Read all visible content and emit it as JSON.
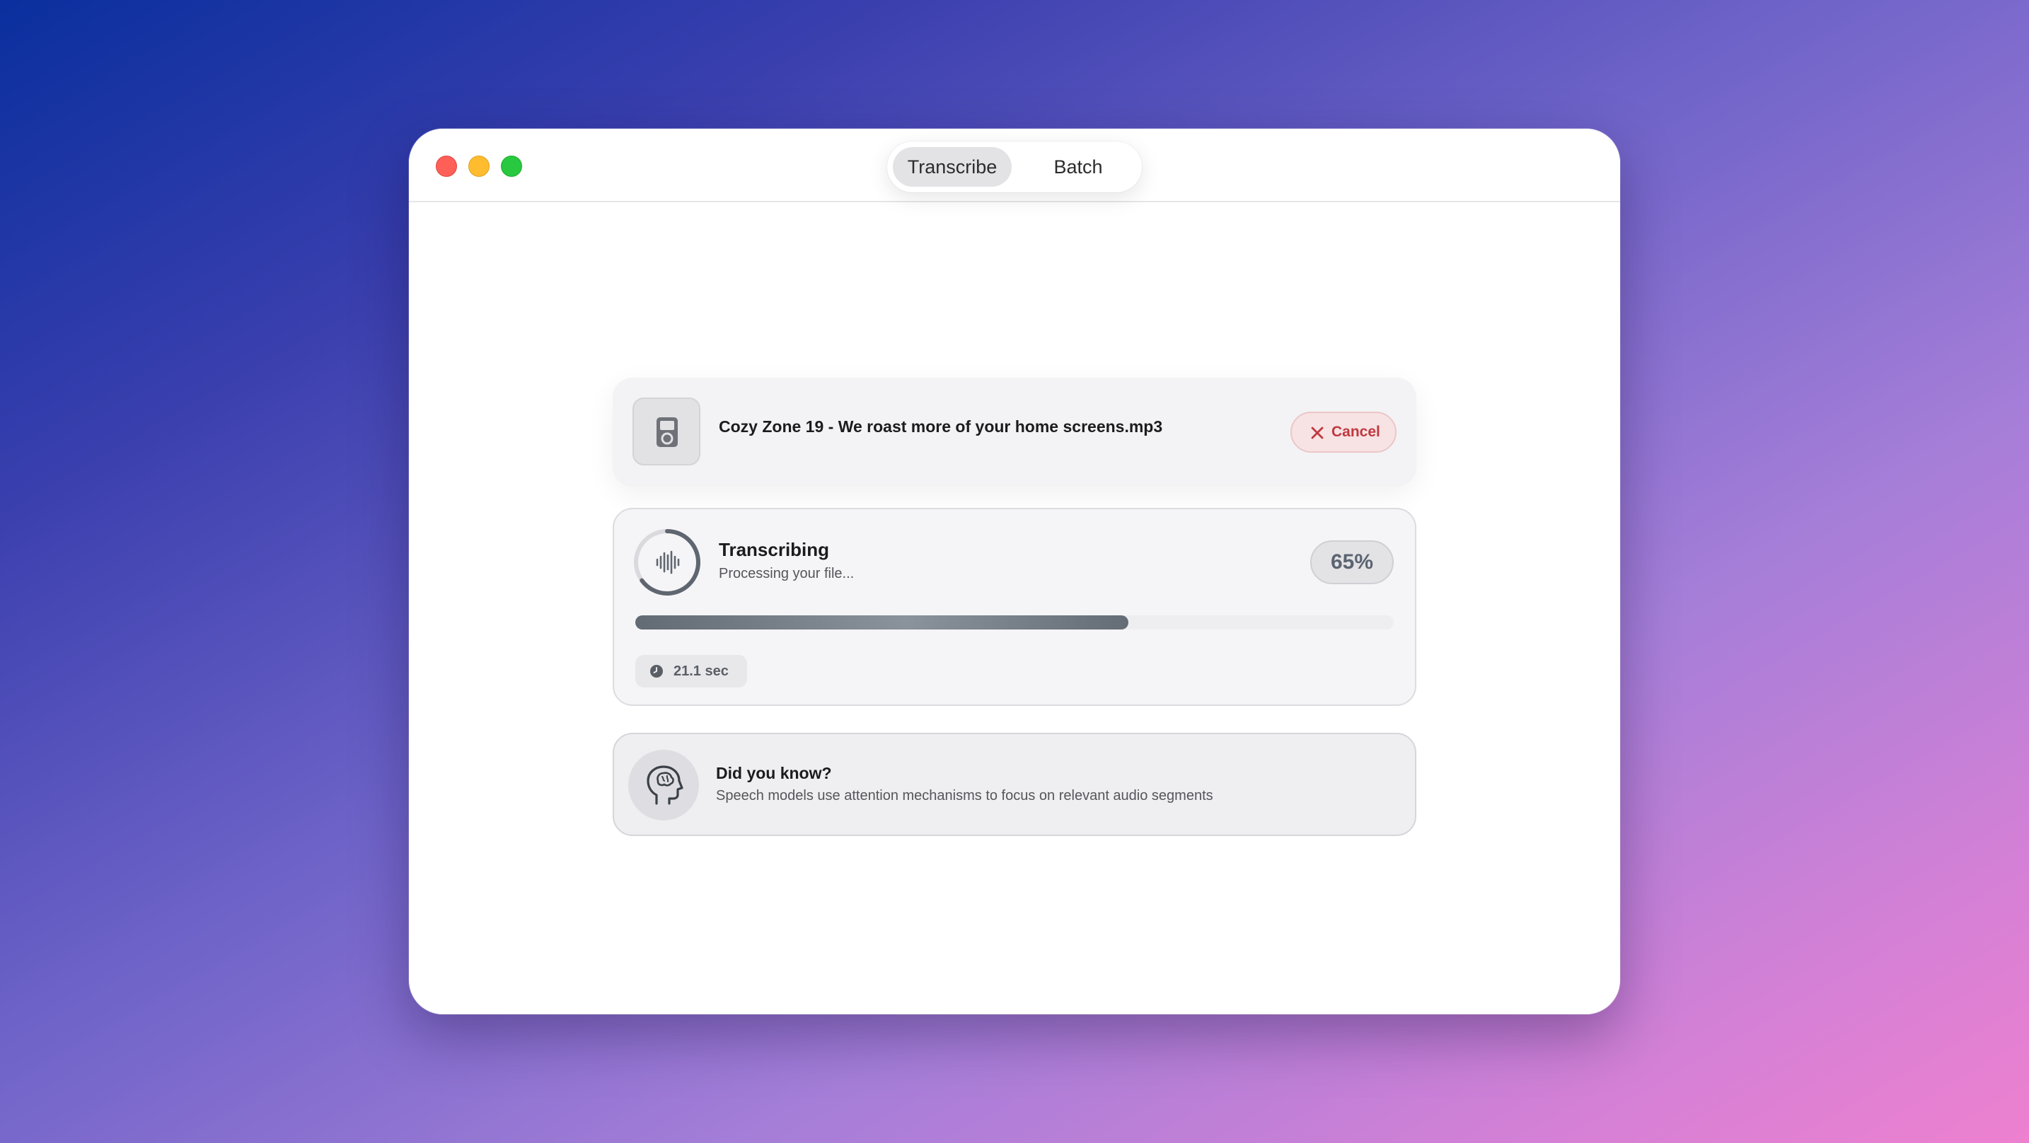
{
  "window": {
    "tabs": [
      {
        "label": "Transcribe",
        "selected": true
      },
      {
        "label": "Batch",
        "selected": false
      }
    ]
  },
  "file": {
    "name": "Cozy Zone 19 - We roast more of your home screens.mp3",
    "icon": "ipod-icon",
    "cancel_label": "Cancel"
  },
  "progress": {
    "title": "Transcribing",
    "subtitle": "Processing your file...",
    "percent_label": "65%",
    "percent_value": 0.65,
    "elapsed": "21.1 sec"
  },
  "tip": {
    "title": "Did you know?",
    "text": "Speech models use attention mechanisms to focus on relevant audio segments",
    "icon": "brain-head-icon"
  },
  "colors": {
    "cancel_text": "#c0393f",
    "cancel_bg": "#f7e3e4",
    "progress_fill": "#6b737d"
  }
}
